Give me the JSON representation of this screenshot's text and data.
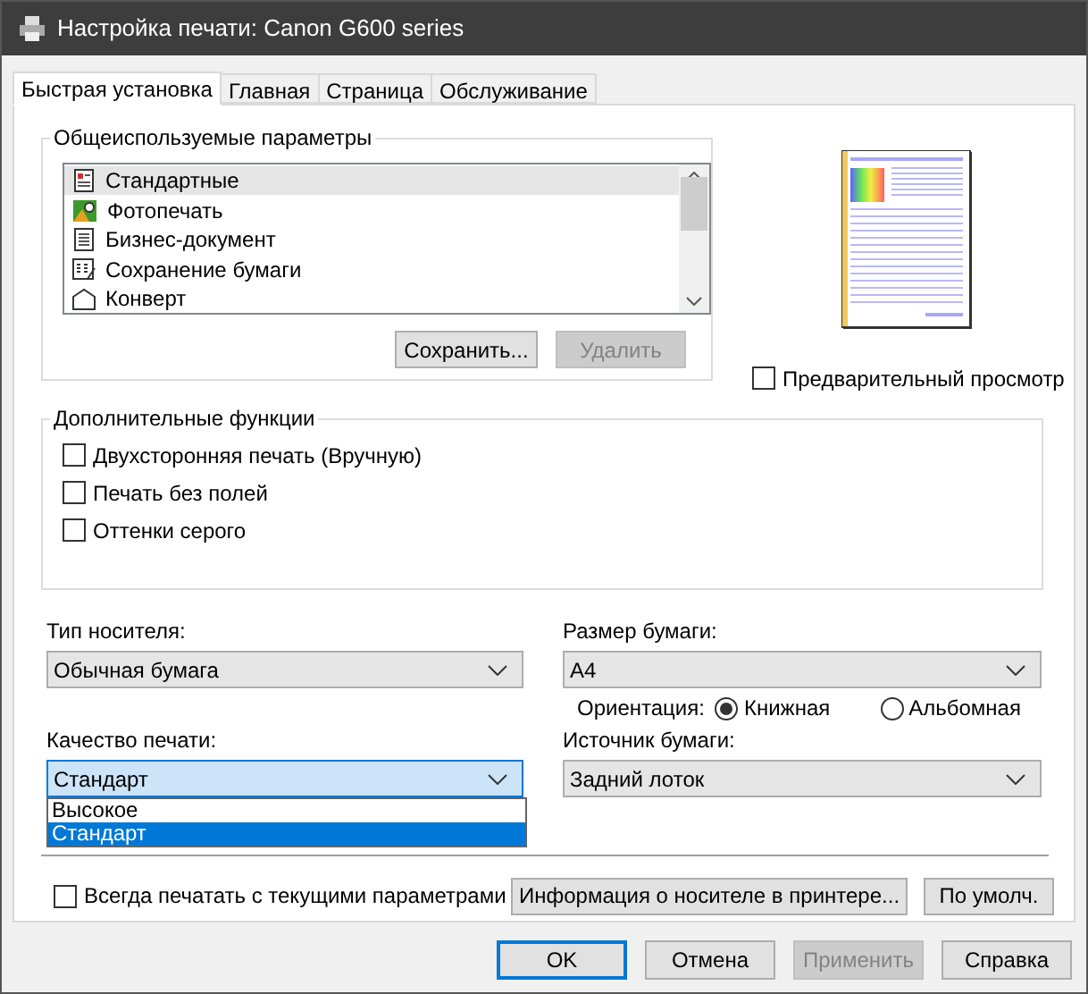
{
  "window": {
    "title": "Настройка печати: Canon G600 series"
  },
  "tabs": [
    {
      "label": "Быстрая установка",
      "selected": true
    },
    {
      "label": "Главная",
      "selected": false
    },
    {
      "label": "Страница",
      "selected": false
    },
    {
      "label": "Обслуживание",
      "selected": false
    }
  ],
  "common_settings": {
    "title": "Общеиспользуемые параметры",
    "items": [
      {
        "label": "Стандартные",
        "kind": "standard",
        "selected": true
      },
      {
        "label": "Фотопечать",
        "kind": "photo",
        "selected": false
      },
      {
        "label": "Бизнес-документ",
        "kind": "document",
        "selected": false
      },
      {
        "label": "Сохранение бумаги",
        "kind": "paper_saving",
        "selected": false
      },
      {
        "label": "Конверт",
        "kind": "envelope",
        "selected": false
      }
    ],
    "buttons": [
      {
        "label": "Сохранить...",
        "disabled": false
      },
      {
        "label": "Удалить",
        "disabled": true
      }
    ]
  },
  "preview": {
    "label": "Предварительный просмотр",
    "checked": false
  },
  "additional_functions": {
    "title": "Дополнительные функции",
    "options": [
      {
        "label": "Двухсторонняя печать (Вручную)",
        "checked": false
      },
      {
        "label": "Печать без полей",
        "checked": false
      },
      {
        "label": "Оттенки серого",
        "checked": false
      }
    ]
  },
  "media_type": {
    "label": "Тип носителя:",
    "value": "Обычная бумага"
  },
  "paper_size": {
    "label": "Размер бумаги:",
    "value": "A4"
  },
  "orientation": {
    "label": "Ориентация:",
    "options": [
      {
        "label": "Книжная",
        "selected": true
      },
      {
        "label": "Альбомная",
        "selected": false
      }
    ]
  },
  "print_quality": {
    "label": "Качество печати:",
    "value": "Стандарт",
    "expanded": true,
    "options": [
      {
        "label": "Высокое",
        "selected": false
      },
      {
        "label": "Стандарт",
        "selected": true
      }
    ]
  },
  "paper_source": {
    "label": "Источник бумаги:",
    "value": "Задний лоток"
  },
  "always_print": {
    "label": "Всегда печатать с текущими параметрами",
    "checked": false
  },
  "panel_buttons": [
    {
      "label": "Информация о носителе в принтере..."
    },
    {
      "label": "По умолч."
    }
  ],
  "dialog_buttons": [
    {
      "label": "OK",
      "default": true,
      "disabled": false
    },
    {
      "label": "Отмена",
      "default": false,
      "disabled": false
    },
    {
      "label": "Применить",
      "default": false,
      "disabled": true
    },
    {
      "label": "Справка",
      "default": false,
      "disabled": false
    }
  ]
}
